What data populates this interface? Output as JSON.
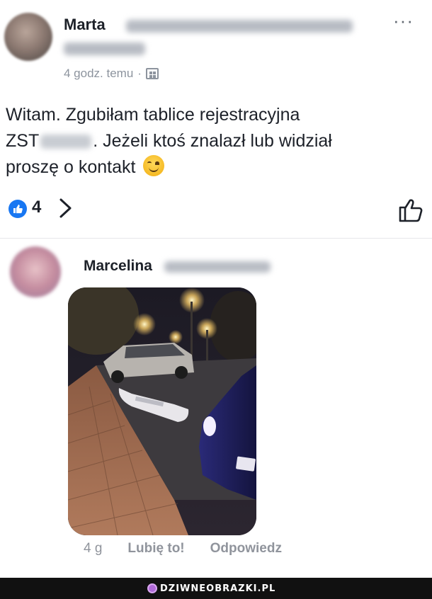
{
  "post": {
    "author_name": "Marta",
    "timestamp": "4 godz. temu",
    "separator": "·",
    "text_line1": "Witam. Zgubiłam tablice rejestracyjna",
    "text_line2_prefix": "ZST",
    "text_line2_suffix": ". Jeżeli ktoś znalazł lub widział",
    "text_line3": "proszę o kontakt",
    "more_label": "···"
  },
  "reactions": {
    "count": "4",
    "like_color": "#1877f2"
  },
  "comment": {
    "author_name": "Marcelina",
    "time": "4 g",
    "like_label": "Lubię to!",
    "reply_label": "Odpowiedz"
  },
  "footer": {
    "watermark": "DZIWNEOBRAZKI.PL"
  },
  "icons": {
    "more": "more-dots-icon",
    "audience": "audience-icon",
    "like_badge": "like-badge-icon",
    "chevron": "chevron-right-icon",
    "thumb": "thumbs-up-icon",
    "emoji": "smiling-face-emoji-icon"
  }
}
